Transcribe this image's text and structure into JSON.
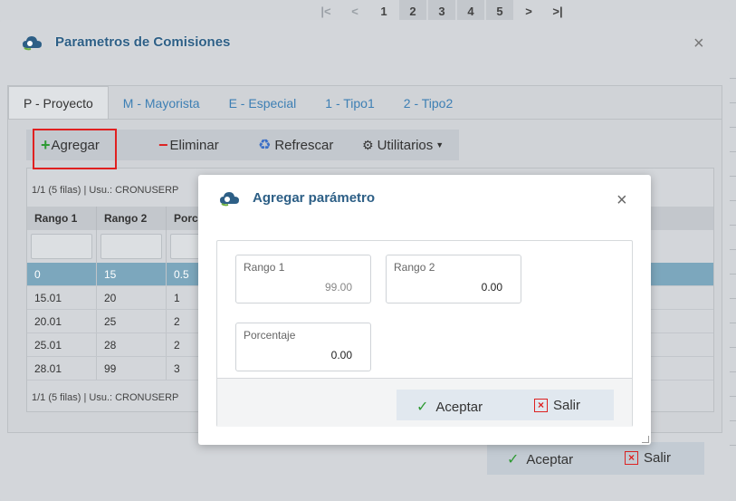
{
  "pager": {
    "first": "|<",
    "prev": "<",
    "pages": [
      "1",
      "2",
      "3",
      "4",
      "5"
    ],
    "next": ">",
    "last": ">|"
  },
  "outer": {
    "title": "Parametros de Comisiones",
    "close": "×",
    "tabs": [
      "P - Proyecto",
      "M - Mayorista",
      "E - Especial",
      "1 - Tipo1",
      "2 - Tipo2"
    ],
    "toolbar": {
      "add": "Agregar",
      "delete": "Eliminar",
      "refresh": "Refrescar",
      "utilities": "Utilitarios"
    },
    "grid": {
      "info_top": "1/1 (5 filas) | Usu.: CRONUSERP",
      "info_bottom": "1/1 (5 filas) | Usu.: CRONUSERP",
      "columns": [
        "Rango 1",
        "Rango 2",
        "Porce"
      ],
      "rows": [
        [
          "0",
          "15",
          "0.5"
        ],
        [
          "15.01",
          "20",
          "1"
        ],
        [
          "20.01",
          "25",
          "2"
        ],
        [
          "25.01",
          "28",
          "2"
        ],
        [
          "28.01",
          "99",
          "3"
        ]
      ]
    },
    "footer": {
      "accept": "Aceptar",
      "exit": "Salir"
    }
  },
  "dialog": {
    "title": "Agregar parámetro",
    "close": "×",
    "fields": {
      "rango1": {
        "label": "Rango 1",
        "value": "99.00"
      },
      "rango2": {
        "label": "Rango 2",
        "value": "0.00"
      },
      "porcentaje": {
        "label": "Porcentaje",
        "value": "0.00"
      }
    },
    "footer": {
      "accept": "Aceptar",
      "exit": "Salir"
    }
  },
  "colors": {
    "accent": "#2d5f86",
    "selected_row": "#7ca7bd",
    "highlight_frame": "#e02020"
  }
}
